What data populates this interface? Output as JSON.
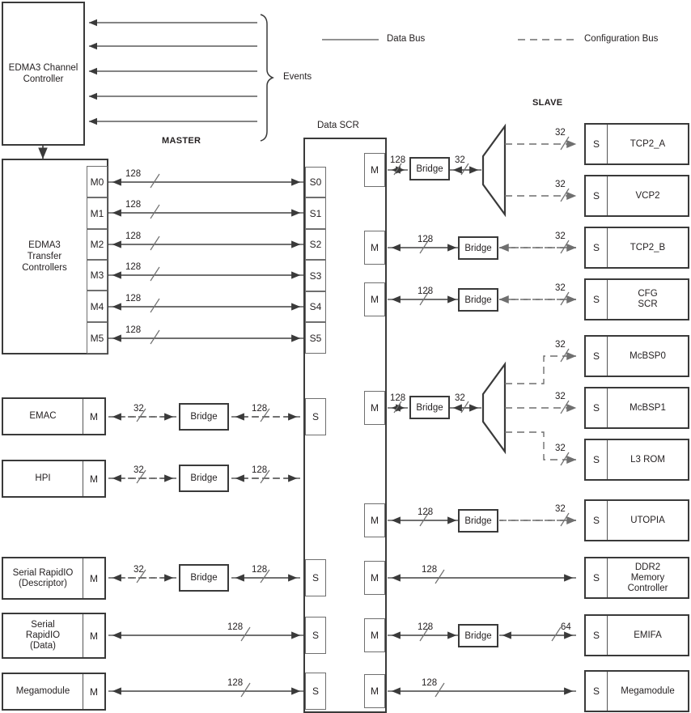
{
  "diagram": {
    "legend": [
      {
        "id": "data-bus",
        "label": "Data Bus",
        "style": "solid"
      },
      {
        "id": "configuration-bus",
        "label": "Configuration Bus",
        "style": "dashed"
      }
    ],
    "section_labels": {
      "master": "MASTER",
      "slave": "SLAVE",
      "events": "Events",
      "data_scr": "Data SCR",
      "scr_width": "128-bit"
    },
    "bridge_label": "Bridge",
    "master_port_label": "M",
    "slave_port_label": "S"
  },
  "edma_channel_controller": {
    "label": "EDMA3 Channel\nController",
    "event_lines": 5
  },
  "edma_transfer_controllers": {
    "label": "EDMA3\nTransfer\nControllers",
    "ports": [
      "M0",
      "M1",
      "M2",
      "M3",
      "M4",
      "M5"
    ],
    "widths": [
      "128",
      "128",
      "128",
      "128",
      "128",
      "128"
    ]
  },
  "scr_slave_ports": [
    "S0",
    "S1",
    "S2",
    "S3",
    "S4",
    "S5"
  ],
  "left_masters": [
    {
      "name": "EMAC",
      "port": "M",
      "width_near": "32",
      "bridge": true,
      "width_far": "128",
      "bus": "config",
      "scr_port": "S"
    },
    {
      "name": "HPI",
      "port": "M",
      "width_near": "32",
      "bridge": true,
      "width_far": "128",
      "bus": "config",
      "scr_port": ""
    },
    {
      "name": "Serial RapidIO\n(Descriptor)",
      "port": "M",
      "width_near": "32",
      "bridge": true,
      "width_far": "128",
      "bus": "config",
      "scr_port": "S"
    },
    {
      "name": "Serial\nRapidIO\n(Data)",
      "port": "M",
      "width_near": "128",
      "bridge": false,
      "width_far": "",
      "bus": "data",
      "scr_port": "S"
    },
    {
      "name": "Megamodule",
      "port": "M",
      "width_near": "128",
      "bridge": false,
      "width_far": "",
      "bus": "data",
      "scr_port": "S"
    }
  ],
  "right_branches": [
    {
      "scr_master_port": "M",
      "width_near": "128",
      "bridge": true,
      "width_mid": "32",
      "near_bus": "data",
      "mux": true,
      "slaves": [
        {
          "name": "TCP2_A",
          "port": "S",
          "width": "32",
          "bus": "config"
        },
        {
          "name": "VCP2",
          "port": "S",
          "width": "32",
          "bus": "config"
        }
      ]
    },
    {
      "scr_master_port": "M",
      "width_near": "128",
      "bridge": true,
      "width_mid": "",
      "near_bus": "data",
      "mux": false,
      "slaves": [
        {
          "name": "TCP2_B",
          "port": "S",
          "width": "32",
          "bus": "config"
        }
      ]
    },
    {
      "scr_master_port": "M",
      "width_near": "128",
      "bridge": true,
      "width_mid": "",
      "near_bus": "data",
      "mux": false,
      "slaves": [
        {
          "name": "CFG\nSCR",
          "port": "S",
          "width": "32",
          "bus": "config"
        }
      ]
    },
    {
      "scr_master_port": "M",
      "width_near": "128",
      "bridge": true,
      "width_mid": "32",
      "near_bus": "data",
      "mux": true,
      "slaves": [
        {
          "name": "McBSP0",
          "port": "S",
          "width": "32",
          "bus": "config"
        },
        {
          "name": "McBSP1",
          "port": "S",
          "width": "32",
          "bus": "config"
        },
        {
          "name": "L3 ROM",
          "port": "S",
          "width": "32",
          "bus": "config"
        }
      ]
    },
    {
      "scr_master_port": "M",
      "width_near": "128",
      "bridge": true,
      "width_mid": "",
      "near_bus": "data",
      "mux": false,
      "slaves": [
        {
          "name": "UTOPIA",
          "port": "S",
          "width": "32",
          "bus": "config"
        }
      ]
    },
    {
      "scr_master_port": "M",
      "width_near": "128",
      "bridge": false,
      "width_mid": "",
      "near_bus": "data",
      "mux": false,
      "slaves": [
        {
          "name": "DDR2\nMemory\nController",
          "port": "S",
          "width": "",
          "bus": "data"
        }
      ]
    },
    {
      "scr_master_port": "M",
      "width_near": "128",
      "bridge": true,
      "width_mid": "",
      "near_bus": "data",
      "mux": false,
      "slaves": [
        {
          "name": "EMIFA",
          "port": "S",
          "width": "64",
          "bus": "data"
        }
      ]
    },
    {
      "scr_master_port": "M",
      "width_near": "128",
      "bridge": false,
      "width_mid": "",
      "near_bus": "data",
      "mux": false,
      "slaves": [
        {
          "name": "Megamodule",
          "port": "S",
          "width": "",
          "bus": "data"
        }
      ]
    }
  ],
  "colors": {
    "line": "#3a3a3a",
    "line_light": "#6f6f6f",
    "text": "#231f20",
    "background": "#ffffff"
  }
}
